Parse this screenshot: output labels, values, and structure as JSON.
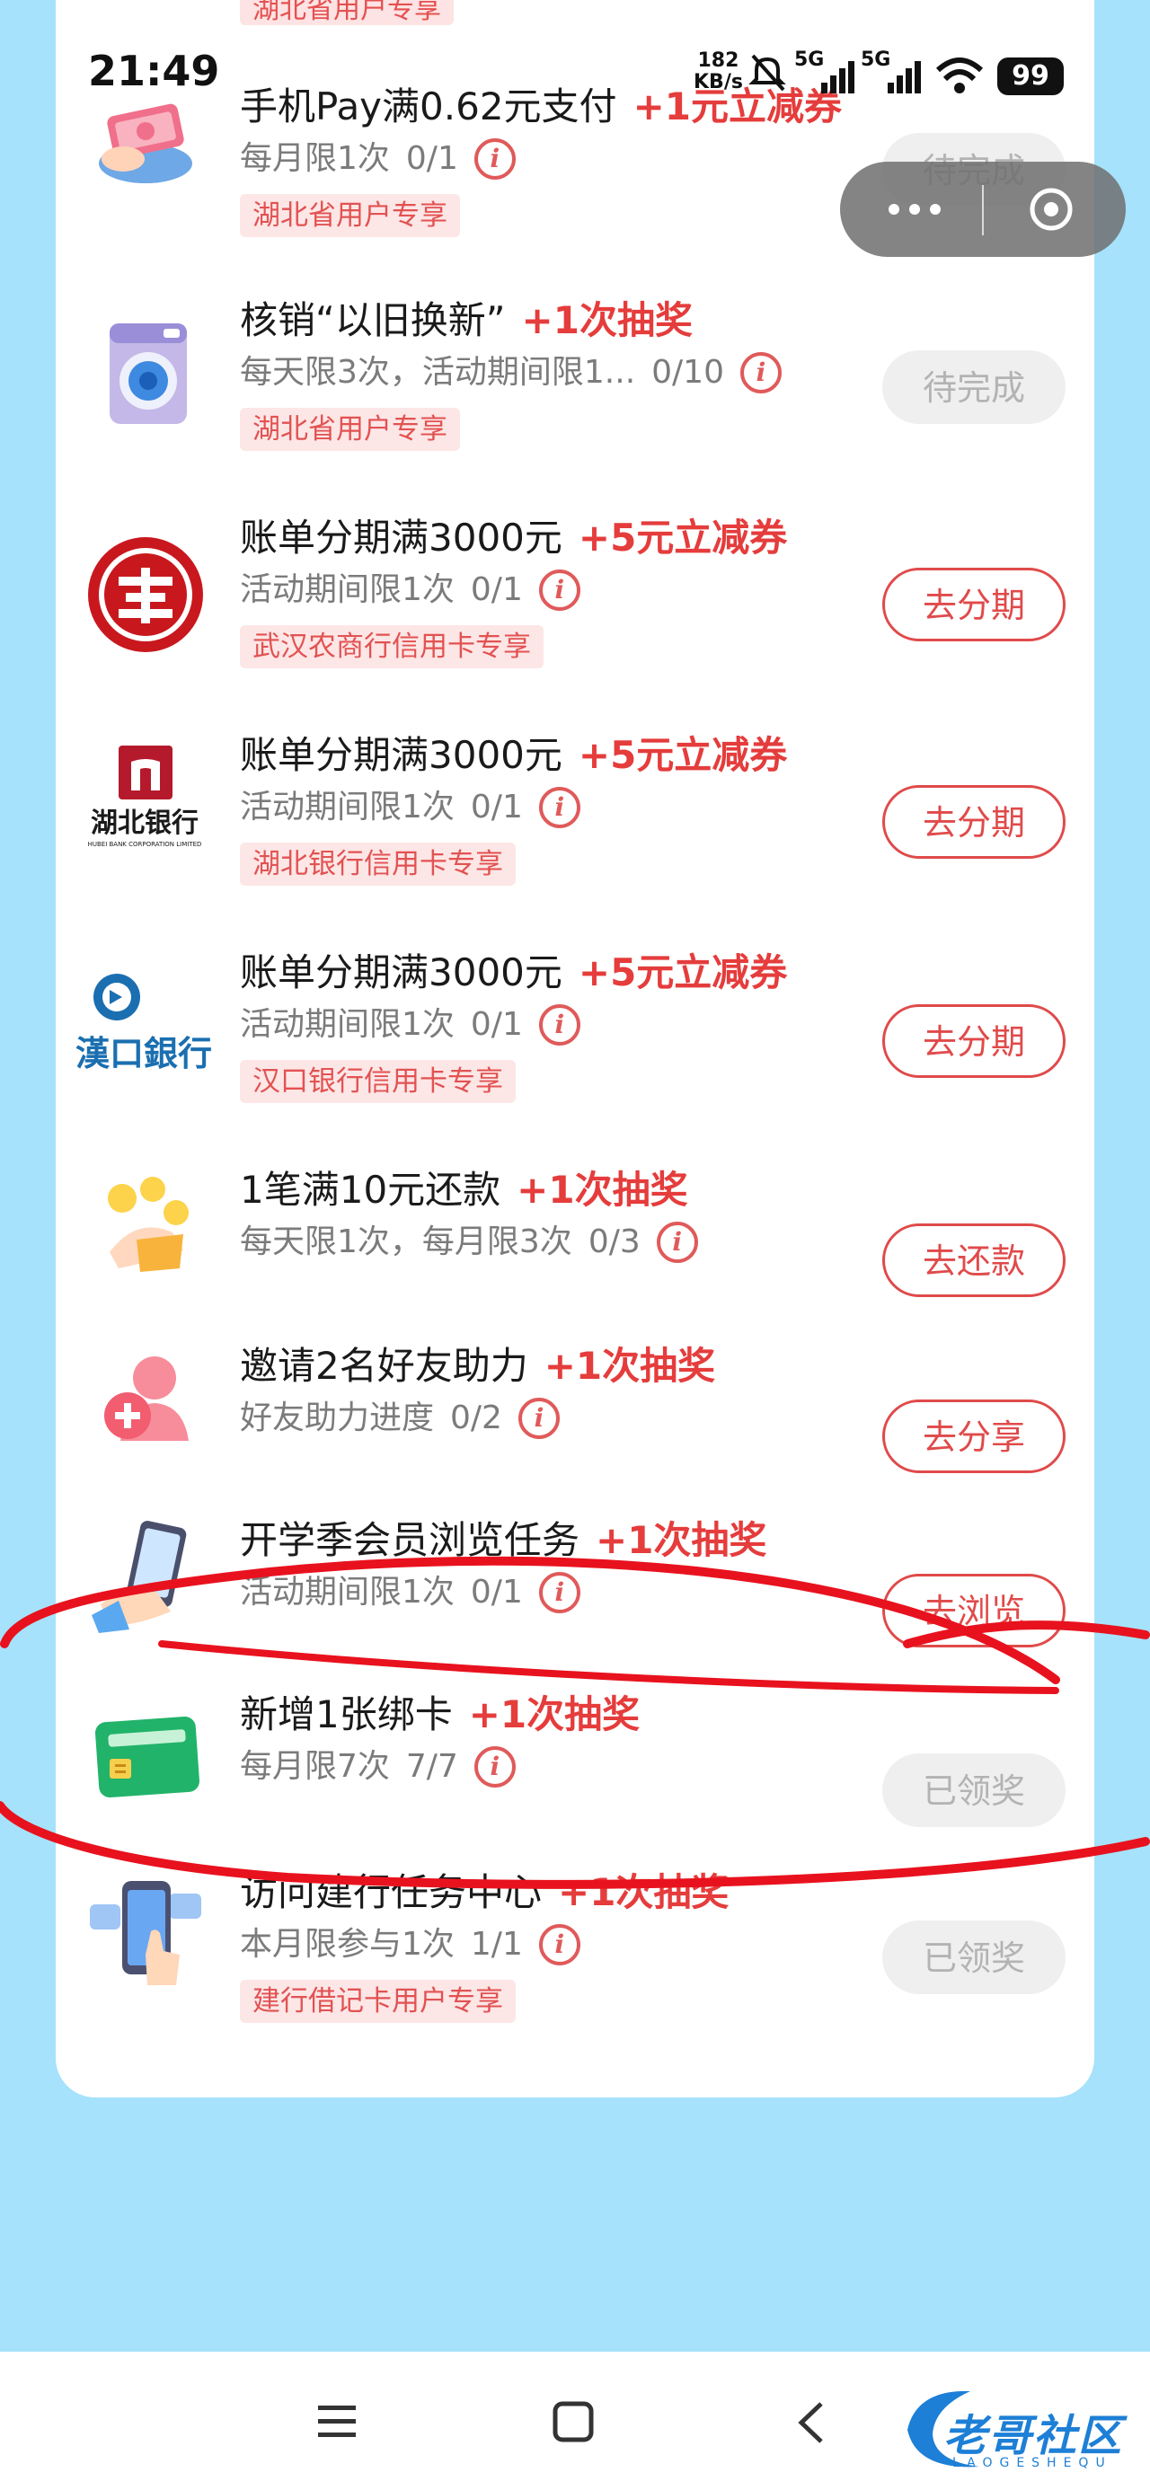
{
  "status_bar": {
    "time": "21:49",
    "net_speed_value": "182",
    "net_speed_unit": "KB/s",
    "signal_1": "5G",
    "signal_2": "5G",
    "battery": "99"
  },
  "top_partial_tag": "湖北省用户专享",
  "tasks": [
    {
      "title": "手机Pay满0.62元支付",
      "reward": "+1元立减券",
      "limit": "每月限1次",
      "progress": "0/1",
      "tag": "湖北省用户专享",
      "button": "待完成",
      "button_state": "done",
      "icon": "cash-hand-icon"
    },
    {
      "title": "核销“以旧换新”",
      "reward": "+1次抽奖",
      "limit": "每天限3次，活动期间限1...",
      "progress": "0/10",
      "tag": "湖北省用户专享",
      "button": "待完成",
      "button_state": "done",
      "icon": "washing-machine-icon"
    },
    {
      "title": "账单分期满3000元",
      "reward": "+5元立减券",
      "limit": "活动期间限1次",
      "progress": "0/1",
      "tag": "武汉农商行信用卡专享",
      "button": "去分期",
      "button_state": "go",
      "icon": "wuhan-rural-bank-logo"
    },
    {
      "title": "账单分期满3000元",
      "reward": "+5元立减券",
      "limit": "活动期间限1次",
      "progress": "0/1",
      "tag": "湖北银行信用卡专享",
      "button": "去分期",
      "button_state": "go",
      "icon": "hubei-bank-logo"
    },
    {
      "title": "账单分期满3000元",
      "reward": "+5元立减券",
      "limit": "活动期间限1次",
      "progress": "0/1",
      "tag": "汉口银行信用卡专享",
      "button": "去分期",
      "button_state": "go",
      "icon": "hankou-bank-logo"
    },
    {
      "title": "1笔满10元还款",
      "reward": "+1次抽奖",
      "limit": "每天限1次，每月限3次",
      "progress": "0/3",
      "tag": "",
      "button": "去还款",
      "button_state": "go",
      "icon": "coin-hand-icon"
    },
    {
      "title": "邀请2名好友助力",
      "reward": "+1次抽奖",
      "limit": "好友助力进度",
      "progress": "0/2",
      "tag": "",
      "button": "去分享",
      "button_state": "go",
      "icon": "invite-friend-icon"
    },
    {
      "title": "开学季会员浏览任务",
      "reward": "+1次抽奖",
      "limit": "活动期间限1次",
      "progress": "0/1",
      "tag": "",
      "button": "去浏览",
      "button_state": "go",
      "icon": "phone-hand-icon"
    },
    {
      "title": "新增1张绑卡",
      "reward": "+1次抽奖",
      "limit": "每月限7次",
      "progress": "7/7",
      "tag": "",
      "button": "已领奖",
      "button_state": "done",
      "icon": "green-card-icon"
    },
    {
      "title": "访问建行任务中心",
      "reward": "+1次抽奖",
      "limit": "本月限参与1次",
      "progress": "1/1",
      "tag": "建行借记卡用户专享",
      "button": "已领奖",
      "button_state": "done",
      "icon": "phone-tap-icon"
    }
  ],
  "watermark": {
    "text": "老哥社区",
    "sub": "LAOGESHEQU"
  },
  "colors": {
    "accent": "#e53c3c",
    "background": "#a6e2fb",
    "annotation": "#e8121e"
  }
}
